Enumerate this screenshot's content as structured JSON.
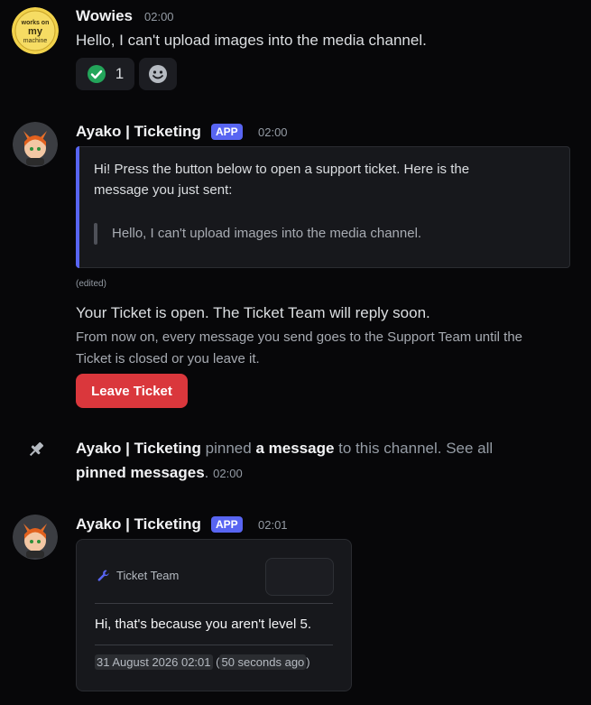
{
  "messages": {
    "m1": {
      "username": "Wowies",
      "time": "02:00",
      "avatar_text": [
        "works on",
        "my",
        "machine"
      ],
      "text": "Hello, I can't upload images into the media channel.",
      "reactions": [
        {
          "icon": "check-circle-icon",
          "count": "1",
          "color": "#23a55a"
        },
        {
          "icon": "add-reaction-icon"
        }
      ]
    },
    "m2": {
      "username": "Ayako | Ticketing",
      "badge": "APP",
      "time": "02:00",
      "embed_line1": "Hi! Press the button below to open a support ticket. Here is the",
      "embed_line2": "message you just sent:",
      "embed_quote": "Hello, I can't upload images into the media channel.",
      "edited": "(edited)",
      "status_title": "Your Ticket is open. The Ticket Team will reply soon.",
      "status_line1": "From now on, every message you send goes to the Support Team until the",
      "status_line2": "Ticket is closed or you leave it.",
      "leave_button": "Leave Ticket"
    },
    "system": {
      "icon": "pin-icon",
      "username": "Ayako | Ticketing",
      "pinned": "pinned",
      "a_message": "a message",
      "to_channel": "to this channel. See all",
      "pinned_messages": "pinned messages",
      "dot": ".",
      "time": "02:00"
    },
    "m3": {
      "username": "Ayako | Ticketing",
      "badge": "APP",
      "time": "02:01",
      "card_title": "Ticket Team",
      "card_icon": "wrench-icon",
      "card_text": "Hi, that's because you aren't level 5.",
      "card_date": "31 August 2026 02:01",
      "card_open_paren": "(",
      "card_relative": "50 seconds ago",
      "card_close_paren": ")"
    }
  },
  "colors": {
    "background": "#070709",
    "accent": "#5865f2",
    "danger": "#da373c",
    "success": "#23a55a"
  }
}
